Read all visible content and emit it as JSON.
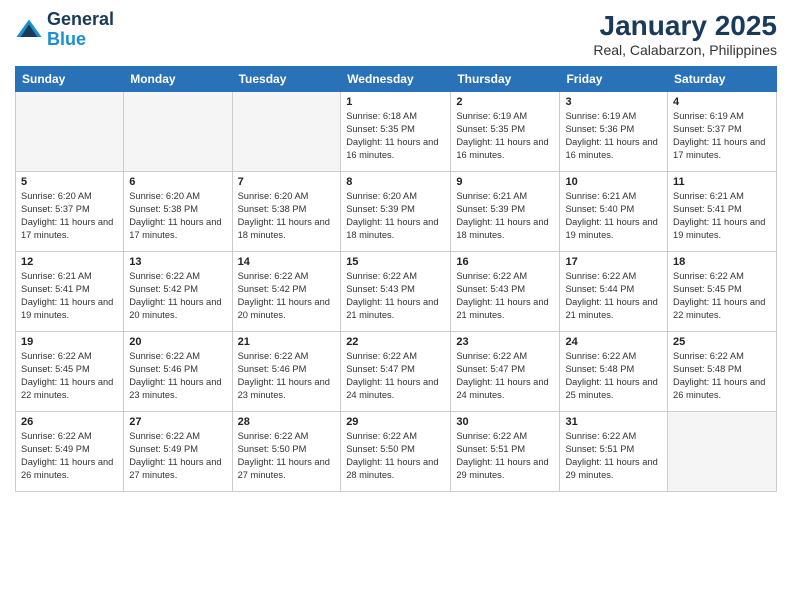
{
  "header": {
    "logo_line1": "General",
    "logo_line2": "Blue",
    "title": "January 2025",
    "subtitle": "Real, Calabarzon, Philippines"
  },
  "days_of_week": [
    "Sunday",
    "Monday",
    "Tuesday",
    "Wednesday",
    "Thursday",
    "Friday",
    "Saturday"
  ],
  "weeks": [
    [
      {
        "day": "",
        "empty": true
      },
      {
        "day": "",
        "empty": true
      },
      {
        "day": "",
        "empty": true
      },
      {
        "day": "1",
        "sunrise": "6:18 AM",
        "sunset": "5:35 PM",
        "daylight": "11 hours and 16 minutes."
      },
      {
        "day": "2",
        "sunrise": "6:19 AM",
        "sunset": "5:35 PM",
        "daylight": "11 hours and 16 minutes."
      },
      {
        "day": "3",
        "sunrise": "6:19 AM",
        "sunset": "5:36 PM",
        "daylight": "11 hours and 16 minutes."
      },
      {
        "day": "4",
        "sunrise": "6:19 AM",
        "sunset": "5:37 PM",
        "daylight": "11 hours and 17 minutes."
      }
    ],
    [
      {
        "day": "5",
        "sunrise": "6:20 AM",
        "sunset": "5:37 PM",
        "daylight": "11 hours and 17 minutes."
      },
      {
        "day": "6",
        "sunrise": "6:20 AM",
        "sunset": "5:38 PM",
        "daylight": "11 hours and 17 minutes."
      },
      {
        "day": "7",
        "sunrise": "6:20 AM",
        "sunset": "5:38 PM",
        "daylight": "11 hours and 18 minutes."
      },
      {
        "day": "8",
        "sunrise": "6:20 AM",
        "sunset": "5:39 PM",
        "daylight": "11 hours and 18 minutes."
      },
      {
        "day": "9",
        "sunrise": "6:21 AM",
        "sunset": "5:39 PM",
        "daylight": "11 hours and 18 minutes."
      },
      {
        "day": "10",
        "sunrise": "6:21 AM",
        "sunset": "5:40 PM",
        "daylight": "11 hours and 19 minutes."
      },
      {
        "day": "11",
        "sunrise": "6:21 AM",
        "sunset": "5:41 PM",
        "daylight": "11 hours and 19 minutes."
      }
    ],
    [
      {
        "day": "12",
        "sunrise": "6:21 AM",
        "sunset": "5:41 PM",
        "daylight": "11 hours and 19 minutes."
      },
      {
        "day": "13",
        "sunrise": "6:22 AM",
        "sunset": "5:42 PM",
        "daylight": "11 hours and 20 minutes."
      },
      {
        "day": "14",
        "sunrise": "6:22 AM",
        "sunset": "5:42 PM",
        "daylight": "11 hours and 20 minutes."
      },
      {
        "day": "15",
        "sunrise": "6:22 AM",
        "sunset": "5:43 PM",
        "daylight": "11 hours and 21 minutes."
      },
      {
        "day": "16",
        "sunrise": "6:22 AM",
        "sunset": "5:43 PM",
        "daylight": "11 hours and 21 minutes."
      },
      {
        "day": "17",
        "sunrise": "6:22 AM",
        "sunset": "5:44 PM",
        "daylight": "11 hours and 21 minutes."
      },
      {
        "day": "18",
        "sunrise": "6:22 AM",
        "sunset": "5:45 PM",
        "daylight": "11 hours and 22 minutes."
      }
    ],
    [
      {
        "day": "19",
        "sunrise": "6:22 AM",
        "sunset": "5:45 PM",
        "daylight": "11 hours and 22 minutes."
      },
      {
        "day": "20",
        "sunrise": "6:22 AM",
        "sunset": "5:46 PM",
        "daylight": "11 hours and 23 minutes."
      },
      {
        "day": "21",
        "sunrise": "6:22 AM",
        "sunset": "5:46 PM",
        "daylight": "11 hours and 23 minutes."
      },
      {
        "day": "22",
        "sunrise": "6:22 AM",
        "sunset": "5:47 PM",
        "daylight": "11 hours and 24 minutes."
      },
      {
        "day": "23",
        "sunrise": "6:22 AM",
        "sunset": "5:47 PM",
        "daylight": "11 hours and 24 minutes."
      },
      {
        "day": "24",
        "sunrise": "6:22 AM",
        "sunset": "5:48 PM",
        "daylight": "11 hours and 25 minutes."
      },
      {
        "day": "25",
        "sunrise": "6:22 AM",
        "sunset": "5:48 PM",
        "daylight": "11 hours and 26 minutes."
      }
    ],
    [
      {
        "day": "26",
        "sunrise": "6:22 AM",
        "sunset": "5:49 PM",
        "daylight": "11 hours and 26 minutes."
      },
      {
        "day": "27",
        "sunrise": "6:22 AM",
        "sunset": "5:49 PM",
        "daylight": "11 hours and 27 minutes."
      },
      {
        "day": "28",
        "sunrise": "6:22 AM",
        "sunset": "5:50 PM",
        "daylight": "11 hours and 27 minutes."
      },
      {
        "day": "29",
        "sunrise": "6:22 AM",
        "sunset": "5:50 PM",
        "daylight": "11 hours and 28 minutes."
      },
      {
        "day": "30",
        "sunrise": "6:22 AM",
        "sunset": "5:51 PM",
        "daylight": "11 hours and 29 minutes."
      },
      {
        "day": "31",
        "sunrise": "6:22 AM",
        "sunset": "5:51 PM",
        "daylight": "11 hours and 29 minutes."
      },
      {
        "day": "",
        "empty": true
      }
    ]
  ],
  "labels": {
    "sunrise": "Sunrise:",
    "sunset": "Sunset:",
    "daylight": "Daylight:"
  }
}
